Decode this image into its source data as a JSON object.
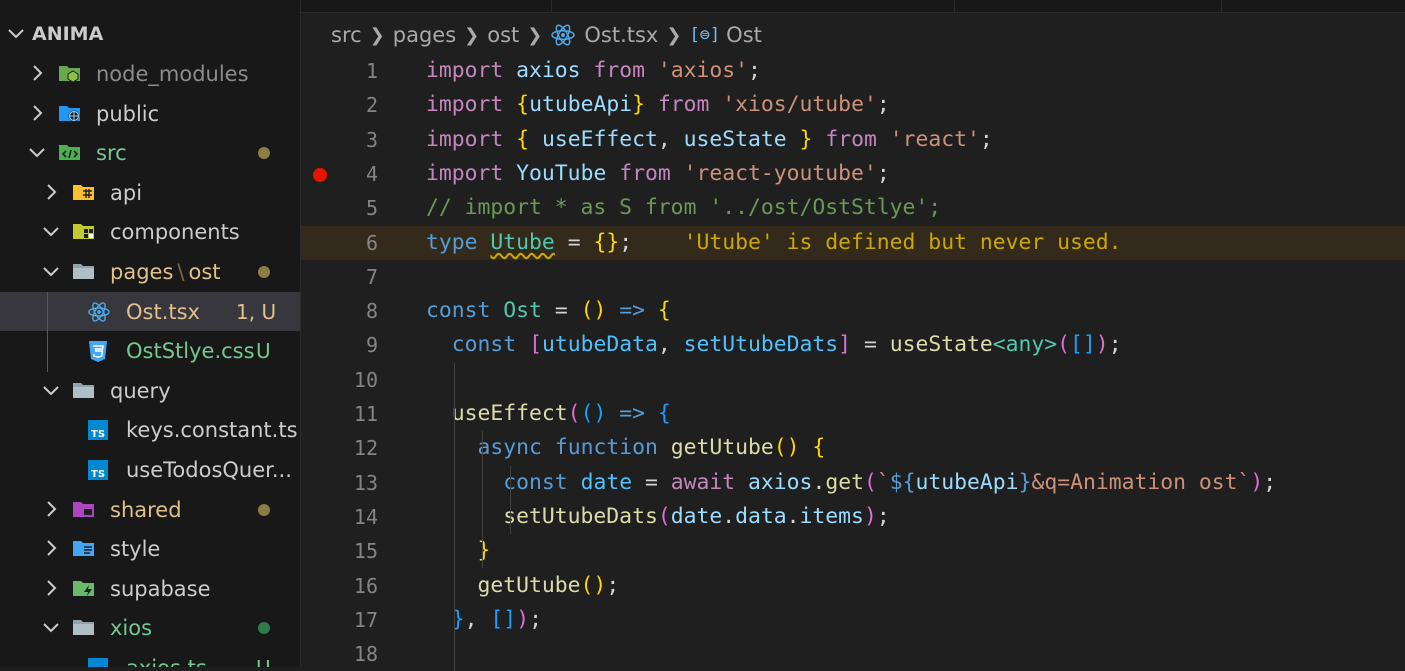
{
  "explorer": {
    "root": "ANIMA",
    "items": [
      {
        "label": "node_modules",
        "color": "#8c8c8c",
        "depth": 0,
        "expanded": false,
        "icon": "node-folder-icon"
      },
      {
        "label": "public",
        "color": "#cccccc",
        "depth": 0,
        "expanded": false,
        "icon": "public-folder-icon"
      },
      {
        "label": "src",
        "color": "#73c991",
        "depth": 0,
        "expanded": true,
        "icon": "src-folder-icon",
        "dot": "#8b7d43"
      },
      {
        "label": "api",
        "color": "#cccccc",
        "depth": 1,
        "expanded": false,
        "icon": "api-folder-icon"
      },
      {
        "label": "components",
        "color": "#cccccc",
        "depth": 1,
        "expanded": true,
        "icon": "components-folder-icon"
      },
      {
        "label": "pages",
        "label2": "ost",
        "color": "#e2c08d",
        "depth": 1,
        "expanded": true,
        "icon": "pages-folder-icon",
        "dot": "#8b7d43"
      },
      {
        "label": "Ost.tsx",
        "color": "#e2c08d",
        "depth": 2,
        "icon": "react-file-icon",
        "badge": "1, U",
        "badgeColor": "#e2c08d",
        "selected": true
      },
      {
        "label": "OstStlye.css",
        "color": "#73c991",
        "depth": 2,
        "icon": "css-file-icon",
        "badge": "U",
        "badgeColor": "#73c991"
      },
      {
        "label": "query",
        "color": "#cccccc",
        "depth": 1,
        "expanded": true,
        "icon": "query-folder-icon"
      },
      {
        "label": "keys.constant.ts",
        "color": "#cccccc",
        "depth": 2,
        "icon": "ts-file-icon"
      },
      {
        "label": "useTodosQuer...",
        "color": "#cccccc",
        "depth": 2,
        "icon": "ts-file-icon"
      },
      {
        "label": "shared",
        "color": "#e2c08d",
        "depth": 1,
        "expanded": false,
        "icon": "shared-folder-icon",
        "dot": "#8b7d43"
      },
      {
        "label": "style",
        "color": "#cccccc",
        "depth": 1,
        "expanded": false,
        "icon": "style-folder-icon"
      },
      {
        "label": "supabase",
        "color": "#cccccc",
        "depth": 1,
        "expanded": false,
        "icon": "supabase-folder-icon"
      },
      {
        "label": "xios",
        "color": "#73c991",
        "depth": 1,
        "expanded": true,
        "icon": "xios-folder-icon",
        "dot": "#2f7a4a"
      },
      {
        "label": "axios.ts",
        "color": "#73c991",
        "depth": 2,
        "icon": "ts-file-icon",
        "badge": "U",
        "badgeColor": "#73c991"
      }
    ]
  },
  "breadcrumb": {
    "parts": [
      "src",
      "pages",
      "ost"
    ],
    "file": "Ost.tsx",
    "symbol": "Ost"
  },
  "editor": {
    "breakpoint_line": 4,
    "warning_line": 6,
    "warning_message": "'Utube' is defined but never used.",
    "lines": [
      [
        [
          "kw",
          "import"
        ],
        [
          "p",
          " "
        ],
        [
          "v",
          "axios"
        ],
        [
          "p",
          " "
        ],
        [
          "kw",
          "from"
        ],
        [
          "p",
          " "
        ],
        [
          "str",
          "'axios'"
        ],
        [
          "p",
          ";"
        ]
      ],
      [
        [
          "kw",
          "import"
        ],
        [
          "p",
          " "
        ],
        [
          "b1",
          "{"
        ],
        [
          "v",
          "utubeApi"
        ],
        [
          "b1",
          "}"
        ],
        [
          "p",
          " "
        ],
        [
          "kw",
          "from"
        ],
        [
          "p",
          " "
        ],
        [
          "str",
          "'xios/utube'"
        ],
        [
          "p",
          ";"
        ]
      ],
      [
        [
          "kw",
          "import"
        ],
        [
          "p",
          " "
        ],
        [
          "b1",
          "{"
        ],
        [
          "p",
          " "
        ],
        [
          "v",
          "useEffect"
        ],
        [
          "p",
          ", "
        ],
        [
          "v",
          "useState"
        ],
        [
          "p",
          " "
        ],
        [
          "b1",
          "}"
        ],
        [
          "p",
          " "
        ],
        [
          "kw",
          "from"
        ],
        [
          "p",
          " "
        ],
        [
          "str",
          "'react'"
        ],
        [
          "p",
          ";"
        ]
      ],
      [
        [
          "kw",
          "import"
        ],
        [
          "p",
          " "
        ],
        [
          "v",
          "YouTube"
        ],
        [
          "p",
          " "
        ],
        [
          "kw",
          "from"
        ],
        [
          "p",
          " "
        ],
        [
          "str",
          "'react-youtube'"
        ],
        [
          "p",
          ";"
        ]
      ],
      [
        [
          "cm",
          "// import * as S from '../ost/OstStlye';"
        ]
      ],
      [
        [
          "kb",
          "type"
        ],
        [
          "p",
          " "
        ],
        [
          "tysq",
          "Utube"
        ],
        [
          "p",
          " = "
        ],
        [
          "b1",
          "{}"
        ],
        [
          "p",
          ";"
        ],
        [
          "p",
          "    "
        ],
        [
          "diag",
          "'Utube' is defined but never used."
        ]
      ],
      [],
      [
        [
          "kb",
          "const"
        ],
        [
          "p",
          " "
        ],
        [
          "ty",
          "Ost"
        ],
        [
          "p",
          " = "
        ],
        [
          "b1",
          "()"
        ],
        [
          "p",
          " "
        ],
        [
          "kb",
          "=>"
        ],
        [
          "p",
          " "
        ],
        [
          "b1",
          "{"
        ]
      ],
      [
        [
          "p",
          "  "
        ],
        [
          "kb",
          "const"
        ],
        [
          "p",
          " "
        ],
        [
          "b2",
          "["
        ],
        [
          "c",
          "utubeData"
        ],
        [
          "p",
          ", "
        ],
        [
          "c",
          "setUtubeDats"
        ],
        [
          "b2",
          "]"
        ],
        [
          "p",
          " = "
        ],
        [
          "fn",
          "useState"
        ],
        [
          "ty",
          "<any>"
        ],
        [
          "b2",
          "("
        ],
        [
          "b3",
          "[]"
        ],
        [
          "b2",
          ")"
        ],
        [
          "p",
          ";"
        ]
      ],
      [],
      [
        [
          "p",
          "  "
        ],
        [
          "fn",
          "useEffect"
        ],
        [
          "b2",
          "("
        ],
        [
          "b3",
          "()"
        ],
        [
          "p",
          " "
        ],
        [
          "kb",
          "=>"
        ],
        [
          "p",
          " "
        ],
        [
          "b3",
          "{"
        ]
      ],
      [
        [
          "p",
          "    "
        ],
        [
          "kb",
          "async"
        ],
        [
          "p",
          " "
        ],
        [
          "kb",
          "function"
        ],
        [
          "p",
          " "
        ],
        [
          "fn",
          "getUtube"
        ],
        [
          "b1",
          "()"
        ],
        [
          "p",
          " "
        ],
        [
          "b1",
          "{"
        ]
      ],
      [
        [
          "p",
          "      "
        ],
        [
          "kb",
          "const"
        ],
        [
          "p",
          " "
        ],
        [
          "c",
          "date"
        ],
        [
          "p",
          " = "
        ],
        [
          "kw",
          "await"
        ],
        [
          "p",
          " "
        ],
        [
          "v",
          "axios"
        ],
        [
          "p",
          "."
        ],
        [
          "fn",
          "get"
        ],
        [
          "b2",
          "("
        ],
        [
          "str",
          "`"
        ],
        [
          "kb",
          "${"
        ],
        [
          "v",
          "utubeApi"
        ],
        [
          "kb",
          "}"
        ],
        [
          "str",
          "&q=Animation ost`"
        ],
        [
          "b2",
          ")"
        ],
        [
          "p",
          ";"
        ]
      ],
      [
        [
          "p",
          "      "
        ],
        [
          "fn",
          "setUtubeDats"
        ],
        [
          "b2",
          "("
        ],
        [
          "v",
          "date"
        ],
        [
          "p",
          "."
        ],
        [
          "v",
          "data"
        ],
        [
          "p",
          "."
        ],
        [
          "v",
          "items"
        ],
        [
          "b2",
          ")"
        ],
        [
          "p",
          ";"
        ]
      ],
      [
        [
          "p",
          "    "
        ],
        [
          "b1",
          "}"
        ]
      ],
      [
        [
          "p",
          "    "
        ],
        [
          "fn",
          "getUtube"
        ],
        [
          "b1",
          "()"
        ],
        [
          "p",
          ";"
        ]
      ],
      [
        [
          "p",
          "  "
        ],
        [
          "b3",
          "}"
        ],
        [
          "p",
          ", "
        ],
        [
          "b3",
          "[]"
        ],
        [
          "b2",
          ")"
        ],
        [
          "p",
          ";"
        ]
      ],
      []
    ]
  }
}
